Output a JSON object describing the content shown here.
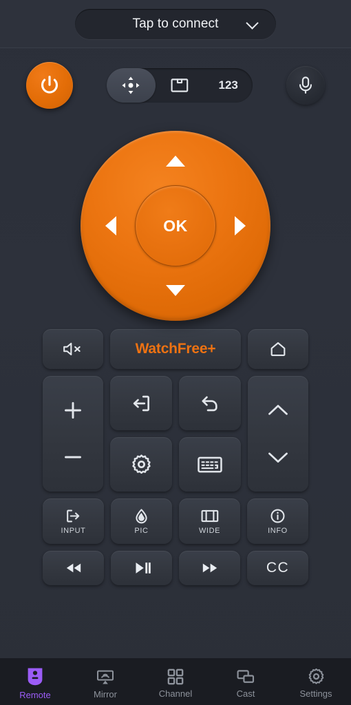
{
  "header": {
    "connect_label": "Tap to connect",
    "chevron_icon": "chevron-down-icon"
  },
  "top_controls": {
    "power": {
      "name": "power-button",
      "icon": "power-icon"
    },
    "mic": {
      "name": "mic-button",
      "icon": "microphone-icon"
    },
    "segmented": {
      "selected": "dpad",
      "items": [
        {
          "key": "dpad",
          "icon": "dpad-move-icon",
          "label": ""
        },
        {
          "key": "touchpad",
          "icon": "touchpad-icon",
          "label": ""
        },
        {
          "key": "numbers",
          "icon": "numeric-keypad-icon",
          "label": "123"
        }
      ]
    }
  },
  "dpad": {
    "ok_label": "OK",
    "up_icon": "arrow-up-icon",
    "down_icon": "arrow-down-icon",
    "left_icon": "arrow-left-icon",
    "right_icon": "arrow-right-icon",
    "color": "#e8700a"
  },
  "rows": {
    "watchfree": {
      "mute": {
        "label": "",
        "icon": "volume-mute-icon"
      },
      "watchfree": {
        "label": "WatchFree+",
        "color": "#ee7212"
      },
      "home": {
        "label": "",
        "icon": "home-icon"
      }
    },
    "middle": {
      "volume": {
        "plus_label": "+",
        "minus_label": "—",
        "name": "volume-rocker"
      },
      "exit": {
        "icon": "exit-icon",
        "label": ""
      },
      "back": {
        "icon": "back-arrow-icon",
        "label": ""
      },
      "settings": {
        "icon": "gear-icon",
        "label": ""
      },
      "keyboard": {
        "icon": "keyboard-icon",
        "label": ""
      },
      "channel": {
        "up_icon": "chevron-up-icon",
        "down_icon": "chevron-down-icon",
        "name": "channel-rocker"
      }
    },
    "functions": [
      {
        "label": "INPUT",
        "icon": "input-source-icon"
      },
      {
        "label": "PIC",
        "icon": "picture-mode-icon"
      },
      {
        "label": "WIDE",
        "icon": "wide-aspect-icon"
      },
      {
        "label": "INFO",
        "icon": "info-icon"
      }
    ],
    "media": [
      {
        "label": "",
        "icon": "rewind-icon"
      },
      {
        "label": "",
        "icon": "play-pause-icon"
      },
      {
        "label": "",
        "icon": "fast-forward-icon"
      },
      {
        "label": "CC",
        "icon": "closed-caption-icon"
      }
    ]
  },
  "bottom_nav": {
    "active": "Remote",
    "active_color": "#9b5cf6",
    "items": [
      {
        "label": "Remote",
        "icon": "remote-icon"
      },
      {
        "label": "Mirror",
        "icon": "screen-mirror-icon"
      },
      {
        "label": "Channel",
        "icon": "grid-channel-icon"
      },
      {
        "label": "Cast",
        "icon": "cast-icon"
      },
      {
        "label": "Settings",
        "icon": "gear-icon"
      }
    ]
  }
}
